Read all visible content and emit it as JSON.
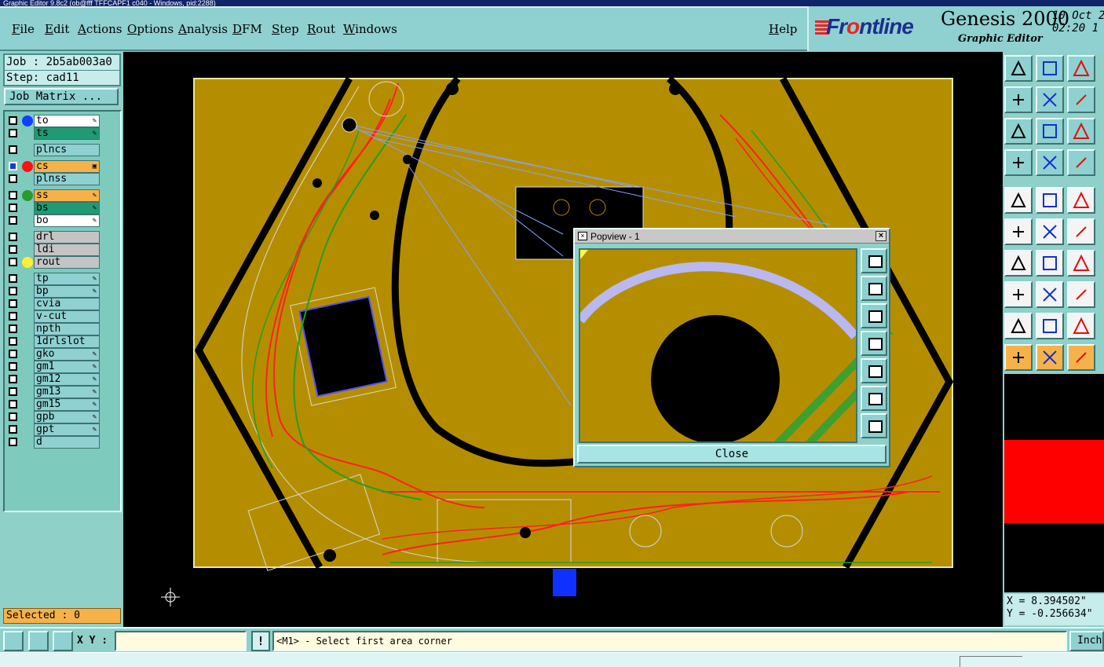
{
  "window": {
    "title": "Graphic Editor 9.8c2 (ob@fff TFFCAPF1 c040 - Windows, pid:2288)"
  },
  "menu": {
    "file": "File",
    "edit": "Edit",
    "actions": "Actions",
    "options": "Options",
    "analysis": "Analysis",
    "dfm": "DFM",
    "step": "Step",
    "rout": "Rout",
    "windows": "Windows",
    "help": "Help"
  },
  "brand": {
    "logo_prefix": "Fr",
    "logo_accent": "o",
    "logo_suffix": "ntline",
    "product": "Genesis 2000",
    "subtitle": "Graphic Editor",
    "date_line1": "10 Oct 2",
    "date_line2": "02:20 1"
  },
  "job": {
    "job_line": "Job : 2b5ab003a0",
    "step_line": "Step: cad11",
    "matrix_button": "Job Matrix ..."
  },
  "layers": [
    {
      "name": "to",
      "bg": "#ffffff",
      "dot": "#1040ff",
      "mark": "✎"
    },
    {
      "name": "ts",
      "bg": "#1f9a72",
      "dot": "",
      "mark": "✎"
    },
    {
      "name": "plncs",
      "bg": "#8fd0d0",
      "dot": "",
      "mark": ""
    },
    {
      "name": "cs",
      "bg": "#f6b24a",
      "dot": "#ff1010",
      "mark": "▣",
      "active": true
    },
    {
      "name": "plnss",
      "bg": "#8fd0d0",
      "dot": "",
      "mark": ""
    },
    {
      "name": "ss",
      "bg": "#f6b24a",
      "dot": "#2a9a2a",
      "mark": "✎"
    },
    {
      "name": "bs",
      "bg": "#1f9a72",
      "dot": "",
      "mark": "✎"
    },
    {
      "name": "bo",
      "bg": "#ffffff",
      "dot": "",
      "mark": "✎"
    },
    {
      "name": "drl",
      "bg": "#c4c4c4",
      "dot": "",
      "mark": ""
    },
    {
      "name": "ldi",
      "bg": "#c4c4c4",
      "dot": "",
      "mark": ""
    },
    {
      "name": "rout",
      "bg": "#c4c4c4",
      "dot": "#ffee33",
      "mark": ""
    },
    {
      "name": "tp",
      "bg": "#8fd0d0",
      "dot": "",
      "mark": "✎"
    },
    {
      "name": "bp",
      "bg": "#8fd0d0",
      "dot": "",
      "mark": "✎"
    },
    {
      "name": "cvia",
      "bg": "#8fd0d0",
      "dot": "",
      "mark": ""
    },
    {
      "name": "v-cut",
      "bg": "#8fd0d0",
      "dot": "",
      "mark": ""
    },
    {
      "name": "npth",
      "bg": "#8fd0d0",
      "dot": "",
      "mark": ""
    },
    {
      "name": "1drlslot",
      "bg": "#8fd0d0",
      "dot": "",
      "mark": ""
    },
    {
      "name": "gko",
      "bg": "#8fd0d0",
      "dot": "",
      "mark": "✎"
    },
    {
      "name": "gm1",
      "bg": "#8fd0d0",
      "dot": "",
      "mark": "✎"
    },
    {
      "name": "gm12",
      "bg": "#8fd0d0",
      "dot": "",
      "mark": "✎"
    },
    {
      "name": "gm13",
      "bg": "#8fd0d0",
      "dot": "",
      "mark": "✎"
    },
    {
      "name": "gm15",
      "bg": "#8fd0d0",
      "dot": "",
      "mark": "✎"
    },
    {
      "name": "gpb",
      "bg": "#8fd0d0",
      "dot": "",
      "mark": "✎"
    },
    {
      "name": "gpt",
      "bg": "#8fd0d0",
      "dot": "",
      "mark": "✎"
    },
    {
      "name": "d",
      "bg": "#8fd0d0",
      "dot": "",
      "mark": ""
    }
  ],
  "selected_text": "Selected : 0",
  "popview": {
    "title": "Popview - 1",
    "close_label": "Close"
  },
  "coords": {
    "x": "X = 8.394502\"",
    "y": "Y = -0.256634\""
  },
  "status": {
    "xy_label": "X Y :",
    "xy_value": "",
    "excl": "!",
    "message": "<M1> - Select first area corner",
    "units": "Inch"
  },
  "colors": {
    "board": "#b58e00",
    "trace_red": "#ff2020",
    "trace_green": "#22a022",
    "silk": "#e8e8e8"
  }
}
